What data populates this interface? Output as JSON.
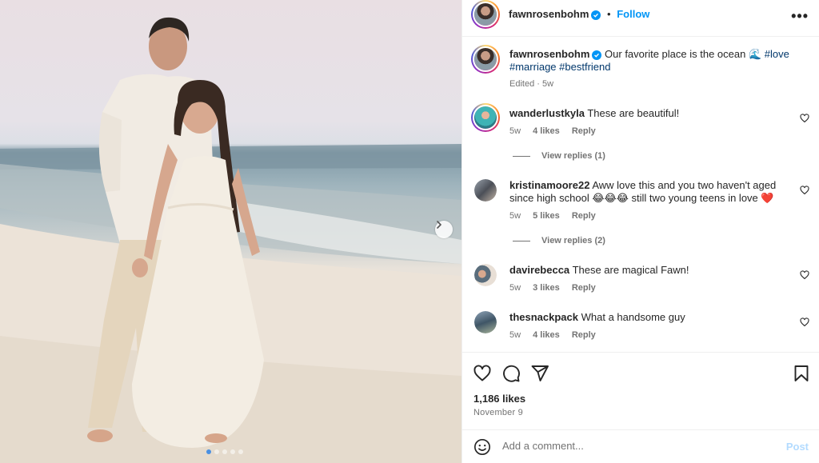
{
  "post": {
    "username": "fawnrosenbohm",
    "follow_label": "Follow",
    "more_label": "•••",
    "caption_text": "Our favorite place is the ocean 🌊",
    "hashtags": [
      "#love",
      "#marriage",
      "#bestfriend"
    ],
    "caption_meta": "Edited · 5w",
    "carousel": {
      "dot_count": 5,
      "active_index": 0
    }
  },
  "comments": [
    {
      "username": "wanderlustkyla",
      "text": "These are beautiful!",
      "time": "5w",
      "likes": "4 likes",
      "reply_label": "Reply",
      "view_replies": "View replies (1)"
    },
    {
      "username": "kristinamoore22",
      "text": "Aww love this and you two haven't aged since high school 😂😂😂 still two young teens in love ❤️",
      "time": "5w",
      "likes": "5 likes",
      "reply_label": "Reply",
      "view_replies": "View replies (2)"
    },
    {
      "username": "davirebecca",
      "text": "These are magical Fawn!",
      "time": "5w",
      "likes": "3 likes",
      "reply_label": "Reply"
    },
    {
      "username": "thesnackpack",
      "text": "What a handsome guy",
      "time": "5w",
      "likes": "4 likes",
      "reply_label": "Reply"
    }
  ],
  "engagement": {
    "likes_count": "1,186 likes",
    "date": "November 9"
  },
  "composer": {
    "placeholder": "Add a comment...",
    "post_label": "Post"
  },
  "icons": [
    "chevron-right-icon",
    "verified-badge-icon",
    "more-icon",
    "heart-icon",
    "comment-icon",
    "share-icon",
    "bookmark-icon",
    "emoji-icon"
  ],
  "colors": {
    "link_blue": "#0095f6",
    "hashtag": "#00376b",
    "secondary_text": "#737373",
    "post_disabled": "#b3dbff"
  }
}
